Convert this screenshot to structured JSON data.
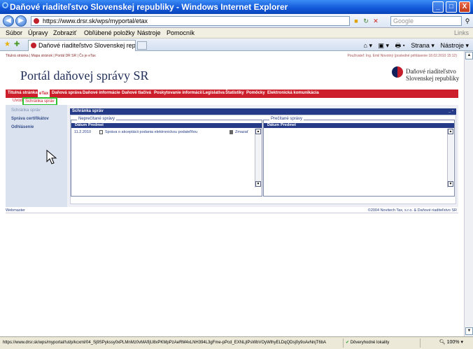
{
  "window": {
    "title": "Daňové riaditeľstvo Slovenskej republiky - Windows Internet Explorer",
    "minimize_glyph": "_",
    "maximize_glyph": "□",
    "close_glyph": "X"
  },
  "address": {
    "back_glyph": "◀",
    "forward_glyph": "▶",
    "url": "https://www.drsr.sk/wps/myportal/etax",
    "search_placeholder": "Google",
    "search_icon": "search-icon"
  },
  "menu": {
    "items": [
      "Súbor",
      "Úpravy",
      "Zobraziť",
      "Obľúbené položky",
      "Nástroje",
      "Pomocník"
    ],
    "links_label": "Links"
  },
  "tabs": {
    "active_tab": "Daňové riaditeľstvo Slovenskej repu...",
    "commands": [
      "⌂ ▾",
      "▣ ▾",
      "🖶 ▾",
      "Strana ▾",
      "Nástroje ▾"
    ]
  },
  "page": {
    "top_breadcrumb": "Titulná stránka | Mapa stránok | Portál DR SR | Čo je eTax",
    "user_line": "Používateľ: Ing. Emil Novotný (posledné prihlásenie 18.02.2010 15:12)",
    "portal_title": "Portál daňovej správy SR",
    "logo_text_line1": "Daňové riaditeľstvo",
    "logo_text_line2": "Slovenskej republiky",
    "red_menu": [
      "Titulná stránka",
      "eTax",
      "Daňová správa",
      "Daňové informácie",
      "Daňové tlačivá",
      "Poskytovanie informácií",
      "Legislatíva",
      "Štatistiky",
      "Pomôcky",
      "Elektronická komunikácia"
    ],
    "sub_nav": [
      "Úvod",
      "Schránka správ"
    ],
    "left_menu": [
      "Schránka správ",
      "Správa certifikátov",
      "Odhlásenie"
    ],
    "portlet_title": "Schránka správ",
    "portlet_controls": "_ ▫",
    "unread": {
      "legend": "Neprečítané správy",
      "col_date": "Dátum",
      "col_subject": "Predmet",
      "rows": [
        {
          "date": "11.2.2010",
          "subject": "Správa o akceptácii podania elektronickou podateľňou",
          "action": "Zmazať"
        }
      ]
    },
    "read": {
      "legend": "Prečítané správy",
      "col_date": "Dátum",
      "col_subject": "Predmet"
    },
    "footer_left": "Webmaster",
    "footer_right": "©2004 Novitech Tax, s.r.o. & Daňové riaditeľstvo SR"
  },
  "status": {
    "url": "https://www.drsr.sk/wps/myportal/!ut/p/kcxml/04_Sj9SPykssy0xPLMnMz0vMAfIjU8xPKMpPzAeRM4xLNH394L3gFme-pPcd_EXNLjtPsWbVOyWlhyELDqQDsj0y9oAvNnjT6bA",
    "trust": "Dôveryhodné lokality",
    "zoom": "100%",
    "colors": {
      "accent_red": "#cc1f2b",
      "navy": "#253b87"
    }
  }
}
